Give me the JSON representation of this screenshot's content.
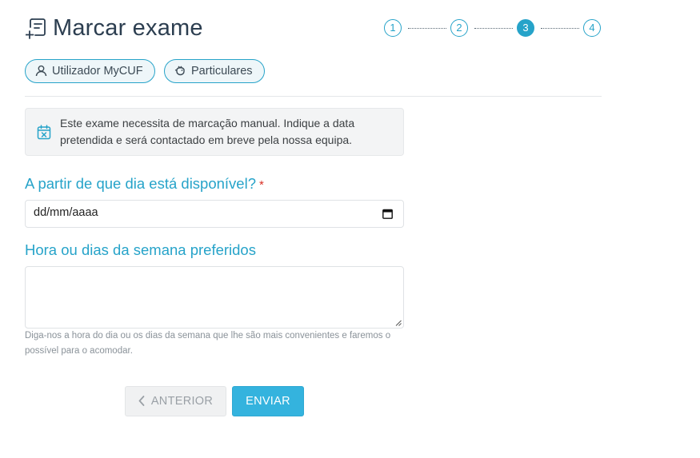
{
  "header": {
    "title": "Marcar exame",
    "icon": "schedule-exam-icon"
  },
  "stepper": {
    "steps": [
      "1",
      "2",
      "3",
      "4"
    ],
    "active_step": 3,
    "accent_color": "#26a3c9"
  },
  "chips": {
    "user": {
      "label": "Utilizador MyCUF",
      "icon": "user-icon"
    },
    "type": {
      "label": "Particulares",
      "icon": "piggy-bank-icon"
    }
  },
  "info": {
    "text": "Este exame necessita de marcação manual. Indique a data pretendida e será contactado em breve pela nossa equipa.",
    "icon": "calendar-cancel-icon"
  },
  "form": {
    "date_label": "A partir de que dia está disponível?",
    "required_mark": "*",
    "date_placeholder": "dd/mm/aaaa",
    "pref_label": "Hora ou dias da semana preferidos",
    "pref_value": "",
    "pref_help": "Diga-nos a hora do dia ou os dias da semana que lhe são mais convenientes e faremos o possível para o acomodar."
  },
  "actions": {
    "prev_label": "ANTERIOR",
    "send_label": "ENVIAR",
    "send_color": "#34b3de"
  }
}
